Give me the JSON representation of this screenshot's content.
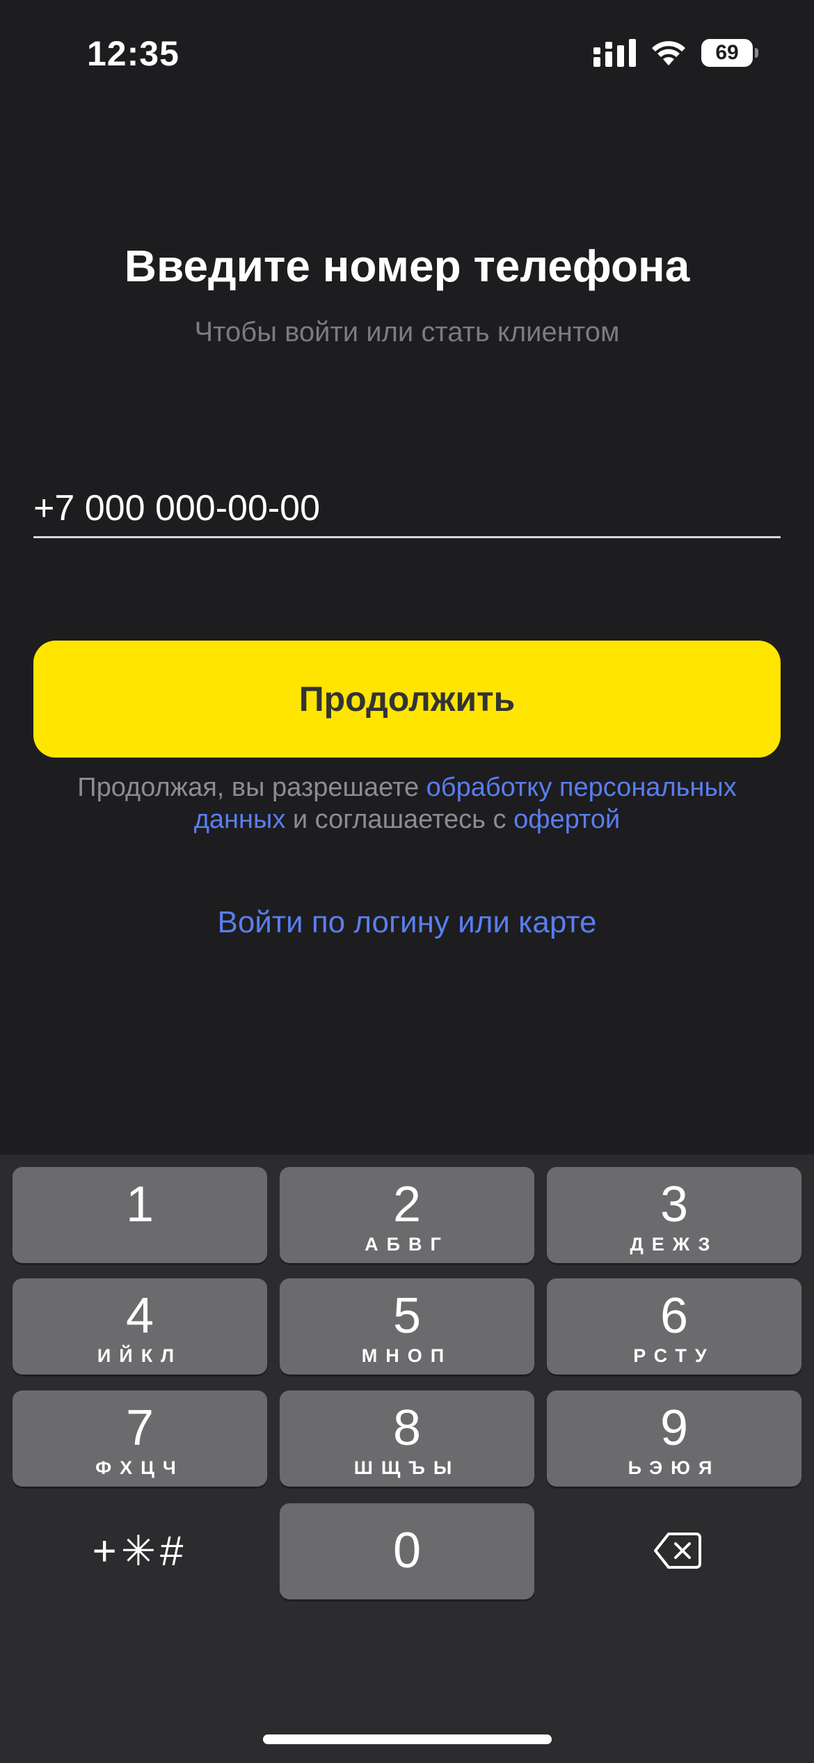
{
  "status_bar": {
    "time": "12:35",
    "battery": "69",
    "icons": [
      "signal-icon",
      "wifi-icon",
      "battery-icon"
    ]
  },
  "header": {
    "title": "Введите номер телефона",
    "subtitle": "Чтобы войти или стать клиентом"
  },
  "form": {
    "phone_placeholder": "+7 000 000-00-00",
    "phone_value": "",
    "continue_label": "Продолжить"
  },
  "consent": {
    "text_before": "Продолжая, вы разрешаете ",
    "link_personal_data": "обработку персональных данных",
    "text_middle": " и соглашаетесь с ",
    "link_offer": "офертой"
  },
  "login_link": "Войти по логину или карте",
  "keypad": {
    "keys": [
      {
        "digit": "1",
        "letters": ""
      },
      {
        "digit": "2",
        "letters": "АБВГ"
      },
      {
        "digit": "3",
        "letters": "ДЕЖЗ"
      },
      {
        "digit": "4",
        "letters": "ИЙКЛ"
      },
      {
        "digit": "5",
        "letters": "МНОП"
      },
      {
        "digit": "6",
        "letters": "РСТУ"
      },
      {
        "digit": "7",
        "letters": "ФХЦЧ"
      },
      {
        "digit": "8",
        "letters": "ШЩЪЫ"
      },
      {
        "digit": "9",
        "letters": "ЬЭЮЯ"
      },
      {
        "digit": "0",
        "letters": ""
      }
    ],
    "symbols_label": "+✳#",
    "backspace_icon": "backspace-icon"
  },
  "colors": {
    "background": "#1d1d1f",
    "accent_button": "#ffe500",
    "link": "#5a7df0",
    "muted_text": "#7c7c80",
    "key": "#6b6b6e",
    "keypad_bg": "#2c2c2e"
  }
}
